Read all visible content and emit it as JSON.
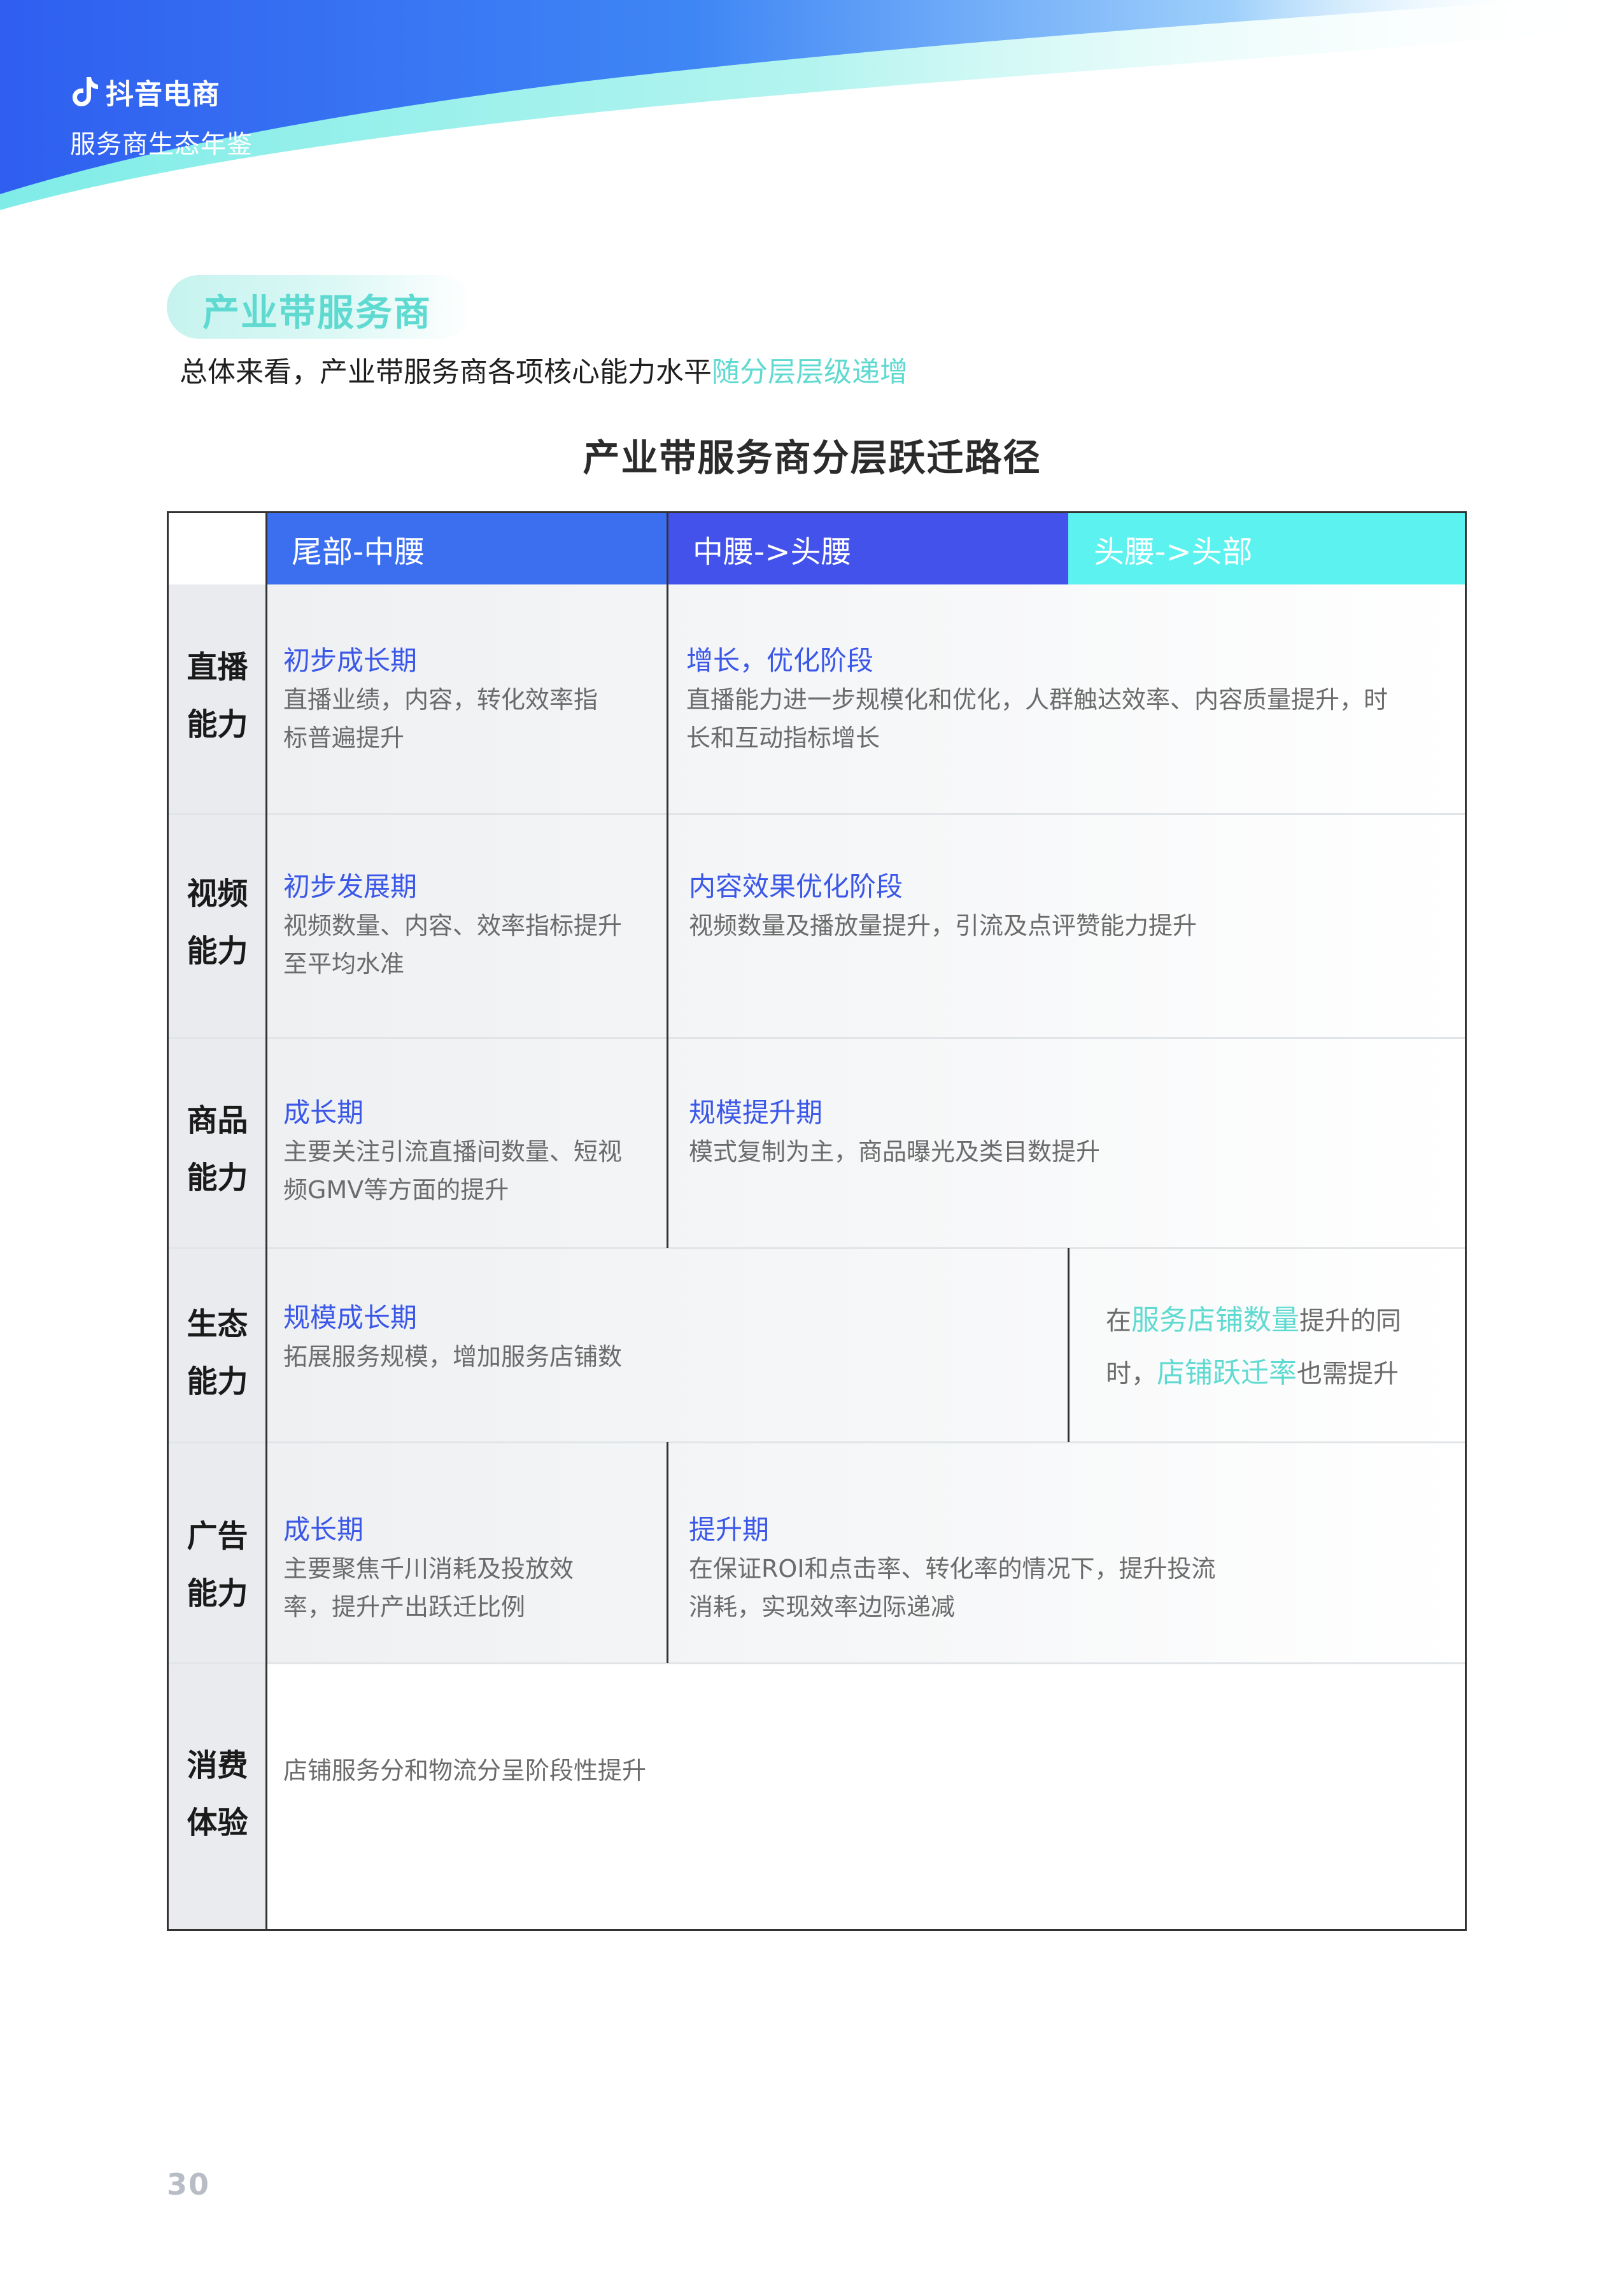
{
  "header": {
    "brand_name": "抖音电商",
    "brand_subtitle": "服务商生态年鉴",
    "logo_icon": "douyin-note-logo"
  },
  "section": {
    "tag": "产业带服务商",
    "summary_prefix": "总体来看，产业带服务商各项核心能力水平",
    "summary_highlight": "随分层层级递增"
  },
  "table": {
    "title": "产业带服务商分层跃迁路径",
    "columns": [
      "尾部-中腰",
      "中腰->头腰",
      "头腰->头部"
    ],
    "rows": [
      {
        "label_line1": "直播",
        "label_line2": "能力",
        "cells": [
          {
            "title": "初步成长期",
            "desc_line1": "直播业绩，内容，转化效率指",
            "desc_line2": "标普遍提升"
          },
          {
            "title": "增长，优化阶段",
            "desc_line1": "直播能力进一步规模化和优化，人群触达效率、内容质量提升，时",
            "desc_line2": "长和互动指标增长"
          }
        ]
      },
      {
        "label_line1": "视频",
        "label_line2": "能力",
        "cells": [
          {
            "title": "初步发展期",
            "desc_line1": "视频数量、内容、效率指标提升",
            "desc_line2": "至平均水准"
          },
          {
            "title": "内容效果优化阶段",
            "desc_line1": "视频数量及播放量提升，引流及点评赞能力提升",
            "desc_line2": ""
          }
        ]
      },
      {
        "label_line1": "商品",
        "label_line2": "能力",
        "cells": [
          {
            "title": "成长期",
            "desc_line1": "主要关注引流直播间数量、短视",
            "desc_line2": "频GMV等方面的提升"
          },
          {
            "title": "规模提升期",
            "desc_line1": "模式复制为主，商品曝光及类目数提升",
            "desc_line2": ""
          }
        ]
      },
      {
        "label_line1": "生态",
        "label_line2": "能力",
        "cells": [
          {
            "title": "规模成长期",
            "desc_line1": "拓展服务规模，增加服务店铺数",
            "desc_line2": ""
          }
        ],
        "note": {
          "p1": "在",
          "h1": "服务店铺数量",
          "p2": "提升的同",
          "p3": "时，",
          "h2": "店铺跃迁率",
          "p4": "也需提升"
        }
      },
      {
        "label_line1": "广告",
        "label_line2": "能力",
        "cells": [
          {
            "title": "成长期",
            "desc_line1": "主要聚焦千川消耗及投放效",
            "desc_line2": "率，提升产出跃迁比例"
          },
          {
            "title": "提升期",
            "desc_line1": "在保证ROI和点击率、转化率的情况下，提升投流",
            "desc_line2": "消耗，实现效率边际递减"
          }
        ]
      },
      {
        "label_line1": "消费",
        "label_line2": "体验",
        "cells": [
          {
            "title": "",
            "desc_line1": "店铺服务分和物流分呈阶段性提升",
            "desc_line2": ""
          }
        ]
      }
    ]
  },
  "footer": {
    "page_number": "30"
  },
  "colors": {
    "brand_blue": "#3b6ff0",
    "deep_blue": "#4352ea",
    "cyan": "#5cf2ef",
    "highlight_teal": "#5fdad1"
  }
}
